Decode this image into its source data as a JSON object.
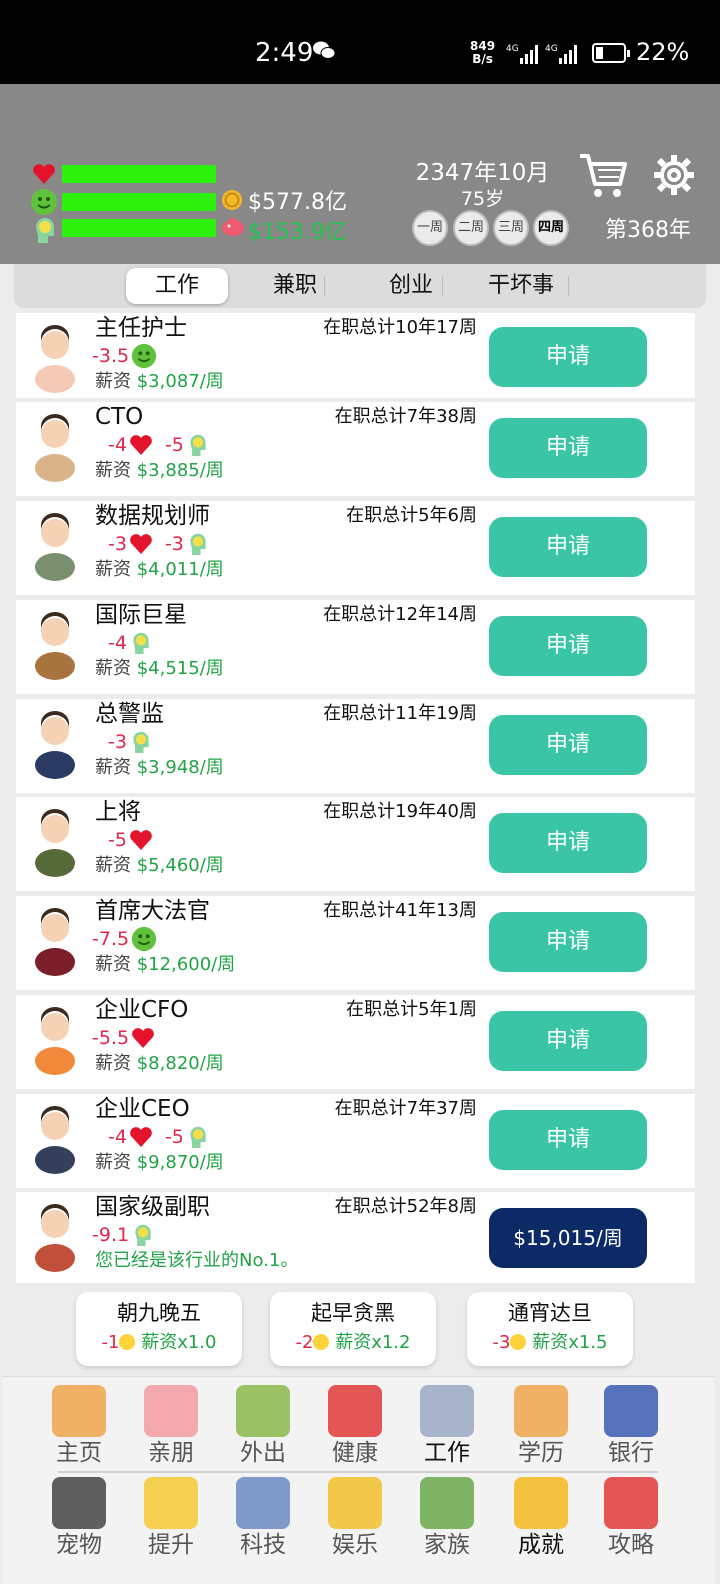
{
  "status_bar": {
    "time": "2:49",
    "net_speed_top": "849",
    "net_speed_bottom": "B/s",
    "battery": "22%"
  },
  "header": {
    "money": "$577.8亿",
    "debt": "$153.9亿",
    "date": "2347年10月",
    "age": "75岁",
    "weeks": [
      "一周",
      "二周",
      "三周",
      "四周"
    ],
    "year": "第368年"
  },
  "tabs": [
    "工作",
    "兼职",
    "创业",
    "干坏事"
  ],
  "salary_label": "薪资",
  "apply_label": "申请",
  "jobs": [
    {
      "name": "主任护士",
      "tenure": "在职总计10年17周",
      "fx1": "-3.5",
      "fx2": "",
      "salary": "$3,087/周",
      "button": "申请"
    },
    {
      "name": "CTO",
      "tenure": "在职总计7年38周",
      "fx1": "-4",
      "fx2": "-5",
      "salary": "$3,885/周",
      "button": "申请"
    },
    {
      "name": "数据规划师",
      "tenure": "在职总计5年6周",
      "fx1": "-3",
      "fx2": "-3",
      "salary": "$4,011/周",
      "button": "申请"
    },
    {
      "name": "国际巨星",
      "tenure": "在职总计12年14周",
      "fx1": "-4",
      "fx2": "",
      "salary": "$4,515/周",
      "button": "申请"
    },
    {
      "name": "总警监",
      "tenure": "在职总计11年19周",
      "fx1": "-3",
      "fx2": "",
      "salary": "$3,948/周",
      "button": "申请"
    },
    {
      "name": "上将",
      "tenure": "在职总计19年40周",
      "fx1": "-5",
      "fx2": "",
      "salary": "$5,460/周",
      "button": "申请"
    },
    {
      "name": "首席大法官",
      "tenure": "在职总计41年13周",
      "fx1": "-7.5",
      "fx2": "",
      "salary": "$12,600/周",
      "button": "申请"
    },
    {
      "name": "企业CFO",
      "tenure": "在职总计5年1周",
      "fx1": "-5.5",
      "fx2": "",
      "salary": "$8,820/周",
      "button": "申请"
    },
    {
      "name": "企业CEO",
      "tenure": "在职总计7年37周",
      "fx1": "-4",
      "fx2": "-5",
      "salary": "$9,870/周",
      "button": "申请"
    },
    {
      "name": "国家级副职",
      "tenure": "在职总计52年8周",
      "fx1": "-9.1",
      "fx2": "",
      "note": "您已经是该行业的No.1。",
      "button": "$15,015/周"
    }
  ],
  "shifts": [
    {
      "title": "朝九晚五",
      "cost": "-1",
      "mult": "薪资x1.0"
    },
    {
      "title": "起早贪黑",
      "cost": "-2",
      "mult": "薪资x1.2"
    },
    {
      "title": "通宵达旦",
      "cost": "-3",
      "mult": "薪资x1.5"
    }
  ],
  "nav_row1": [
    "主页",
    "亲朋",
    "外出",
    "健康",
    "工作",
    "学历",
    "银行"
  ],
  "nav_row2": [
    "宠物",
    "提升",
    "科技",
    "娱乐",
    "家族",
    "成就",
    "攻略"
  ],
  "colors": {
    "accent_green": "#3ac6a6",
    "salary_green": "#21a445",
    "negative_red": "#e0264a",
    "bar_green": "#2ef10d",
    "header_gray": "#888888",
    "top_button_navy": "#0b2a66"
  }
}
